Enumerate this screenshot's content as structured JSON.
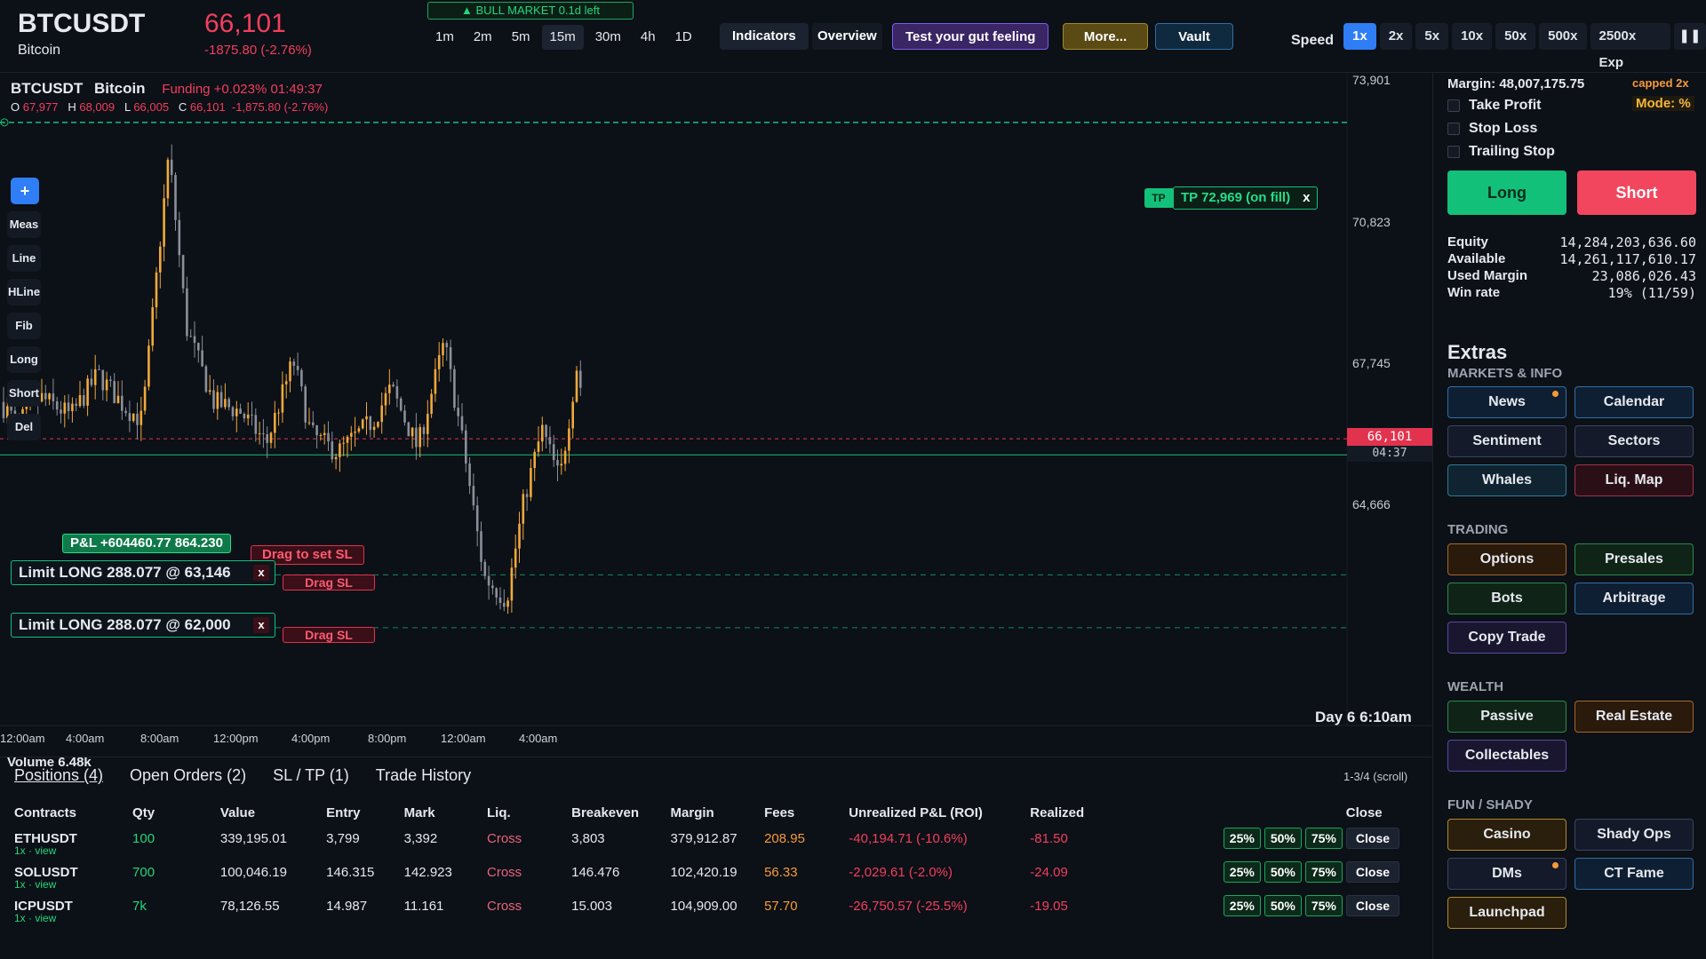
{
  "header": {
    "symbol": "BTCUSDT",
    "name": "Bitcoin",
    "price": "66,101",
    "change": "-1875.80 (-2.76%)",
    "market_badge": "▲ BULL MARKET   0.1d left",
    "timeframes": [
      "1m",
      "2m",
      "5m",
      "15m",
      "30m",
      "4h",
      "1D"
    ],
    "active_timeframe": "15m",
    "buttons": {
      "indicators": "Indicators",
      "overview": "Overview",
      "gut": "Test your gut feeling",
      "more": "More...",
      "vault": "Vault"
    },
    "speed_label": "Speed",
    "speeds": [
      "1x",
      "2x",
      "5x",
      "10x",
      "50x",
      "500x",
      "2500x Exp"
    ],
    "active_speed": "1x",
    "pause": "❚❚"
  },
  "chart": {
    "symbol": "BTCUSDT",
    "name": "Bitcoin",
    "funding": "Funding +0.023%   01:49:37",
    "ohlc": {
      "o": "67,977",
      "h": "68,009",
      "l": "66,005",
      "c": "66,101",
      "chg": "-1,875.80 (-2.76%)"
    },
    "tools": [
      "+",
      "Meas",
      "Line",
      "HLine",
      "Fib",
      "Long",
      "Short",
      "Del"
    ],
    "y_labels": [
      "73,901",
      "70,823",
      "67,745",
      "64,666"
    ],
    "last_price": "66,101",
    "countdown": "04:37",
    "x_labels": [
      "12:00am",
      "4:00am",
      "8:00am",
      "12:00pm",
      "4:00pm",
      "8:00pm",
      "12:00am",
      "4:00am"
    ],
    "day_label": "Day 6  6:10am",
    "volume_label": "Volume  6.48k",
    "tp_tag": "TP",
    "tp_label": "TP 72,969 (on fill)",
    "pnl_label": "P&L +604460.77  864.230",
    "drag_sl": "Drag to set SL",
    "limit_orders": [
      {
        "label": "Limit LONG 288.077 @ 63,146",
        "price": 63146
      },
      {
        "label": "Limit LONG 288.077 @ 62,000",
        "price": 62000
      }
    ],
    "drag_sl_short": "Drag SL",
    "close_x": "x",
    "chart_data": {
      "type": "candlestick",
      "y_range": [
        61900,
        74200
      ],
      "last": 66101,
      "tp": 72969,
      "entry": 65750
    }
  },
  "bottom": {
    "tabs": [
      "Positions (4)",
      "Open Orders (2)",
      "SL / TP (1)",
      "Trade History"
    ],
    "pagination": "1-3/4  (scroll)",
    "columns": [
      "Contracts",
      "Qty",
      "Value",
      "Entry",
      "Mark",
      "Liq.",
      "Breakeven",
      "Margin",
      "Fees",
      "Unrealized P&L (ROI)",
      "Realized",
      "Close"
    ],
    "rows": [
      {
        "contract": "ETHUSDT",
        "sub": "1x · view",
        "qty": "100",
        "value": "339,195.01",
        "entry": "3,799",
        "mark": "3,392",
        "liq": "Cross",
        "breakeven": "3,803",
        "margin": "379,912.87",
        "fees": "208.95",
        "upnl": "-40,194.71 (-10.6%)",
        "realized": "-81.50"
      },
      {
        "contract": "SOLUSDT",
        "sub": "1x · view",
        "qty": "700",
        "value": "100,046.19",
        "entry": "146.315",
        "mark": "142.923",
        "liq": "Cross",
        "breakeven": "146.476",
        "margin": "102,420.19",
        "fees": "56.33",
        "upnl": "-2,029.61 (-2.0%)",
        "realized": "-24.09"
      },
      {
        "contract": "ICPUSDT",
        "sub": "1x · view",
        "qty": "7k",
        "value": "78,126.55",
        "entry": "14.987",
        "mark": "11.161",
        "liq": "Cross",
        "breakeven": "15.003",
        "margin": "104,909.00",
        "fees": "57.70",
        "upnl": "-26,750.57 (-25.5%)",
        "realized": "-19.05"
      }
    ],
    "close_pcts": [
      "25%",
      "50%",
      "75%"
    ],
    "close_label": "Close"
  },
  "side": {
    "margin_line": "Margin: 48,007,175.75",
    "capped": "capped 2x",
    "mode": "Mode: %",
    "take_profit": "Take Profit",
    "stop_loss": "Stop Loss",
    "trailing_stop": "Trailing Stop",
    "long": "Long",
    "short": "Short",
    "account": [
      {
        "label": "Equity",
        "value": "14,284,203,636.60"
      },
      {
        "label": "Available",
        "value": "14,261,117,610.17"
      },
      {
        "label": "Used Margin",
        "value": "23,086,026.43"
      },
      {
        "label": "Win rate",
        "value": "19% (11/59)"
      }
    ],
    "extras_title": "Extras",
    "sections": {
      "markets": "MARKETS & INFO",
      "trading": "TRADING",
      "wealth": "WEALTH",
      "fun": "FUN / SHADY"
    },
    "markets": [
      "News",
      "Calendar",
      "Sentiment",
      "Sectors",
      "Whales",
      "Liq. Map"
    ],
    "trading": [
      "Options",
      "Presales",
      "Bots",
      "Arbitrage",
      "Copy Trade"
    ],
    "wealth": [
      "Passive",
      "Real Estate",
      "Collectables"
    ],
    "fun": [
      "Casino",
      "Shady Ops",
      "DMs",
      "CT Fame",
      "Launchpad"
    ],
    "colors": {
      "green": "#13c07a",
      "red": "#f2465f",
      "orange": "#f59b3a",
      "blue": "#2f7ef5",
      "purple": "#7a5cf0"
    }
  }
}
